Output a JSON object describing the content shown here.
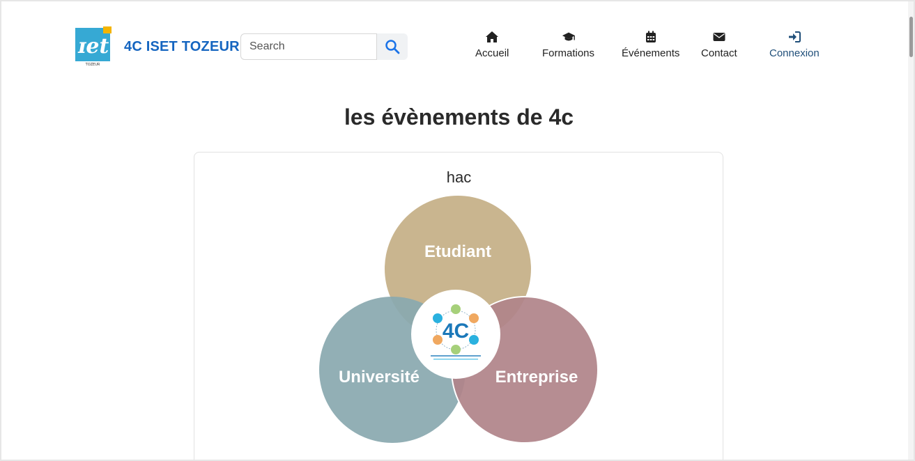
{
  "navbar": {
    "brand": "4C ISET TOZEUR",
    "logo_caption": "TOZEUR",
    "search": {
      "placeholder": "Search",
      "value": ""
    },
    "items": [
      {
        "label": "Accueil",
        "icon": "home-icon"
      },
      {
        "label": "Formations",
        "icon": "graduation-cap-icon"
      },
      {
        "label": "Événements",
        "icon": "calendar-icon"
      },
      {
        "label": "Contact",
        "icon": "envelope-icon"
      },
      {
        "label": "Connexion",
        "icon": "sign-in-icon"
      }
    ]
  },
  "main": {
    "title": "les évènements de 4c",
    "card": {
      "title": "hac",
      "venn": {
        "top": "Etudiant",
        "left": "Université",
        "right": "Entreprise",
        "center_logo": "4C"
      }
    }
  },
  "colors": {
    "brand": "#1565c0",
    "etudiant": "#c9b58f",
    "universite": "#8aa9af",
    "entreprise": "#b0848a"
  }
}
